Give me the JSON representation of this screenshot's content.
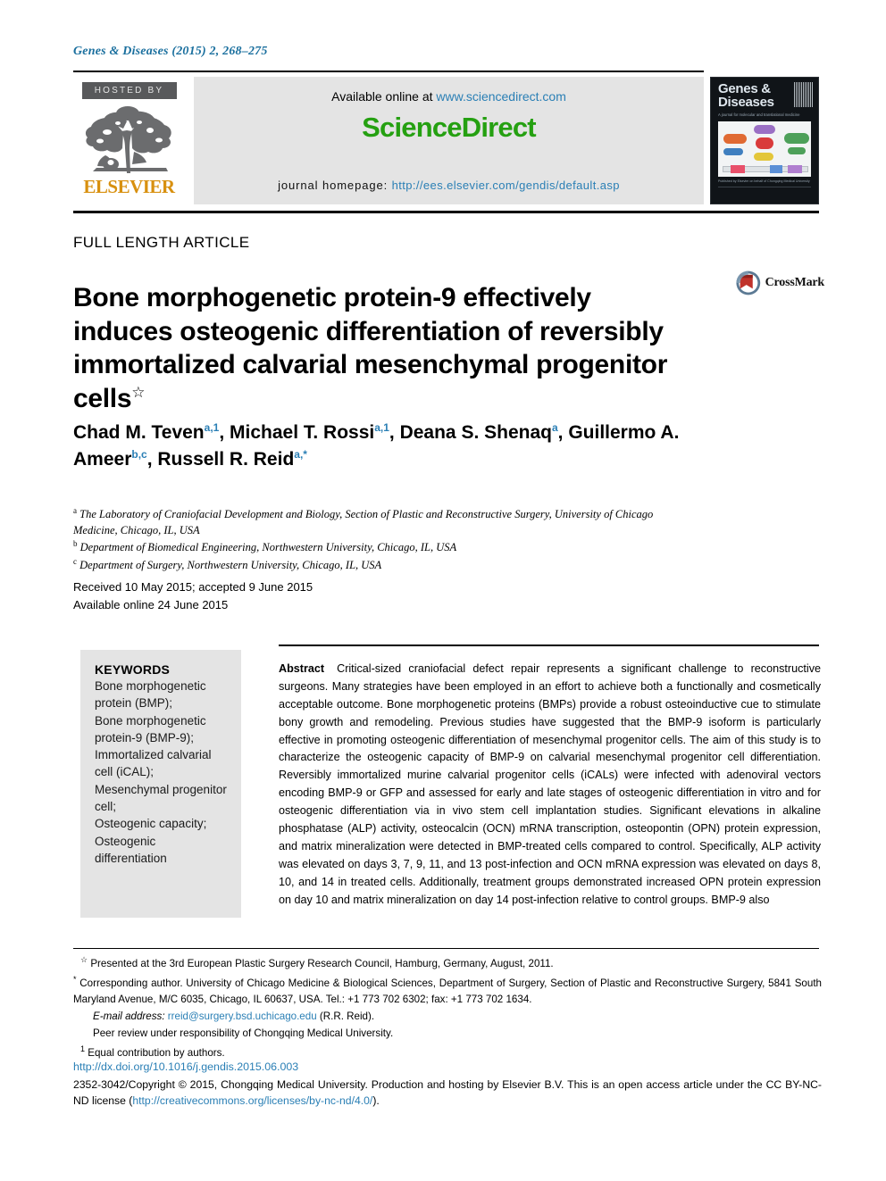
{
  "running_head": "Genes & Diseases (2015) 2, 268–275",
  "header": {
    "hosted_by": "HOSTED BY",
    "publisher": "ELSEVIER",
    "available_online_prefix": "Available online at ",
    "available_online_url": "www.sciencedirect.com",
    "sciencedirect_logo": "ScienceDirect",
    "journal_homepage_label": "journal homepage: ",
    "journal_homepage_url": "http://ees.elsevier.com/gendis/default.asp",
    "cover": {
      "title_line1": "Genes &",
      "title_line2": "Diseases",
      "subtitle": "A journal for molecular and translational medicine",
      "footer": "Published by Elsevier on behalf of Chongqing Medical University"
    }
  },
  "article": {
    "type": "FULL LENGTH ARTICLE",
    "title": "Bone morphogenetic protein-9 effectively induces osteogenic differentiation of reversibly immortalized calvarial mesenchymal progenitor cells",
    "title_marker": "☆",
    "crossmark_label": "CrossMark"
  },
  "authors": [
    {
      "name": "Chad M. Teven",
      "marks": "a,1",
      "sep": ", "
    },
    {
      "name": "Michael T. Rossi",
      "marks": "a,1",
      "sep": ", "
    },
    {
      "name": "Deana S. Shenaq",
      "marks": "a",
      "sep": ", "
    },
    {
      "name": "Guillermo A. Ameer",
      "marks": "b,c",
      "sep": ", "
    },
    {
      "name": "Russell R. Reid",
      "marks": "a,*",
      "sep": ""
    }
  ],
  "affiliations": [
    {
      "mark": "a",
      "text": "The Laboratory of Craniofacial Development and Biology, Section of Plastic and Reconstructive Surgery, University of Chicago Medicine, Chicago, IL, USA"
    },
    {
      "mark": "b",
      "text": "Department of Biomedical Engineering, Northwestern University, Chicago, IL, USA"
    },
    {
      "mark": "c",
      "text": "Department of Surgery, Northwestern University, Chicago, IL, USA"
    }
  ],
  "dates": {
    "received_accepted": "Received 10 May 2015; accepted 9 June 2015",
    "available_online": "Available online 24 June 2015"
  },
  "keywords": {
    "heading": "KEYWORDS",
    "items": [
      "Bone morphogenetic protein (BMP);",
      "Bone morphogenetic protein-9 (BMP-9);",
      "Immortalized calvarial cell (iCAL);",
      "Mesenchymal progenitor cell;",
      "Osteogenic capacity;",
      "Osteogenic differentiation"
    ]
  },
  "abstract": {
    "heading": "Abstract",
    "text": "Critical-sized craniofacial defect repair represents a significant challenge to reconstructive surgeons. Many strategies have been employed in an effort to achieve both a functionally and cosmetically acceptable outcome. Bone morphogenetic proteins (BMPs) provide a robust osteoinductive cue to stimulate bony growth and remodeling. Previous studies have suggested that the BMP-9 isoform is particularly effective in promoting osteogenic differentiation of mesenchymal progenitor cells. The aim of this study is to characterize the osteogenic capacity of BMP-9 on calvarial mesenchymal progenitor cell differentiation. Reversibly immortalized murine calvarial progenitor cells (iCALs) were infected with adenoviral vectors encoding BMP-9 or GFP and assessed for early and late stages of osteogenic differentiation in vitro and for osteogenic differentiation via in vivo stem cell implantation studies. Significant elevations in alkaline phosphatase (ALP) activity, osteocalcin (OCN) mRNA transcription, osteopontin (OPN) protein expression, and matrix mineralization were detected in BMP-treated cells compared to control. Specifically, ALP activity was elevated on days 3, 7, 9, 11, and 13 post-infection and OCN mRNA expression was elevated on days 8, 10, and 14 in treated cells. Additionally, treatment groups demonstrated increased OPN protein expression on day 10 and matrix mineralization on day 14 post-infection relative to control groups. BMP-9 also"
  },
  "footnotes": {
    "presented": "Presented at the 3rd European Plastic Surgery Research Council, Hamburg, Germany, August, 2011.",
    "presented_mark": "☆",
    "corresponding_mark": "*",
    "corresponding": "Corresponding author. University of Chicago Medicine & Biological Sciences, Department of Surgery, Section of Plastic and Reconstructive Surgery, 5841 South Maryland Avenue, M/C 6035, Chicago, IL 60637, USA. Tel.: +1 773 702 6302; fax: +1 773 702 1634.",
    "email_label": "E-mail address:",
    "email": "rreid@surgery.bsd.uchicago.edu",
    "email_owner": "(R.R. Reid).",
    "peer_review": "Peer review under responsibility of Chongqing Medical University.",
    "equal_mark": "1",
    "equal_contribution": "Equal contribution by authors."
  },
  "bottom": {
    "doi": "http://dx.doi.org/10.1016/j.gendis.2015.06.003",
    "copyright_a": "2352-3042/Copyright © 2015, Chongqing Medical University. Production and hosting by Elsevier B.V. This is an open access article under the CC BY-NC-ND license (",
    "license_url": "http://creativecommons.org/licenses/by-nc-nd/4.0/",
    "copyright_b": ")."
  },
  "colors": {
    "link": "#2a7fb5",
    "sciencedirect_green": "#25a011",
    "elsevier_orange": "#d8900f",
    "band_gray": "#e4e4e4"
  }
}
